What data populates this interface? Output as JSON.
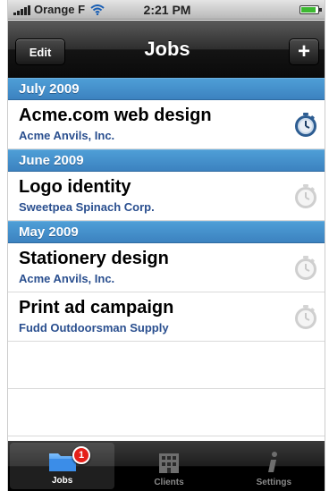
{
  "status_bar": {
    "carrier": "Orange F",
    "time": "2:21 PM"
  },
  "nav": {
    "title": "Jobs",
    "edit_label": "Edit",
    "add_label": "+"
  },
  "sections": [
    {
      "header": "July 2009",
      "rows": [
        {
          "title": "Acme.com web design",
          "client": "Acme Anvils, Inc.",
          "timer": "active"
        }
      ]
    },
    {
      "header": "June 2009",
      "rows": [
        {
          "title": "Logo identity",
          "client": "Sweetpea Spinach Corp.",
          "timer": "inactive"
        }
      ]
    },
    {
      "header": "May 2009",
      "rows": [
        {
          "title": "Stationery design",
          "client": "Acme Anvils, Inc.",
          "timer": "inactive"
        },
        {
          "title": "Print ad campaign",
          "client": "Fudd Outdoorsman Supply",
          "timer": "inactive"
        }
      ]
    }
  ],
  "tabs": [
    {
      "label": "Jobs",
      "icon": "folder-icon",
      "badge": "1",
      "active": true
    },
    {
      "label": "Clients",
      "icon": "building-icon",
      "active": false
    },
    {
      "label": "Settings",
      "icon": "info-icon",
      "active": false
    }
  ],
  "colors": {
    "section_header": "#3c82c0",
    "client_text": "#2a4f8f",
    "badge": "#e52019"
  }
}
